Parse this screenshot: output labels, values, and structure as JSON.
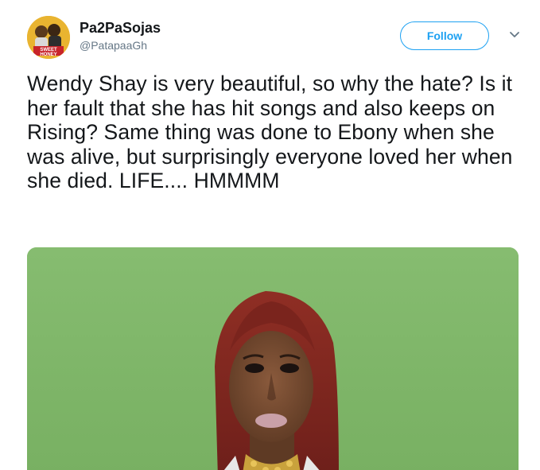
{
  "tweet": {
    "author": {
      "display_name": "Pa2PaSojas",
      "handle": "@PatapaaGh",
      "avatar_text": "SWEET HONEY"
    },
    "follow_label": "Follow",
    "text": "Wendy Shay is very beautiful, so why the hate? Is it her fault that she has hit songs and also keeps on Rising? Same thing was done to Ebony when she was alive, but surprisingly everyone loved her when she died. LIFE.... HMMMM"
  },
  "colors": {
    "accent": "#1da1f2",
    "name": "#14171a",
    "handle": "#657786",
    "media_background": "#7fb769"
  },
  "icons": {
    "caret": "chevron-down-icon"
  }
}
